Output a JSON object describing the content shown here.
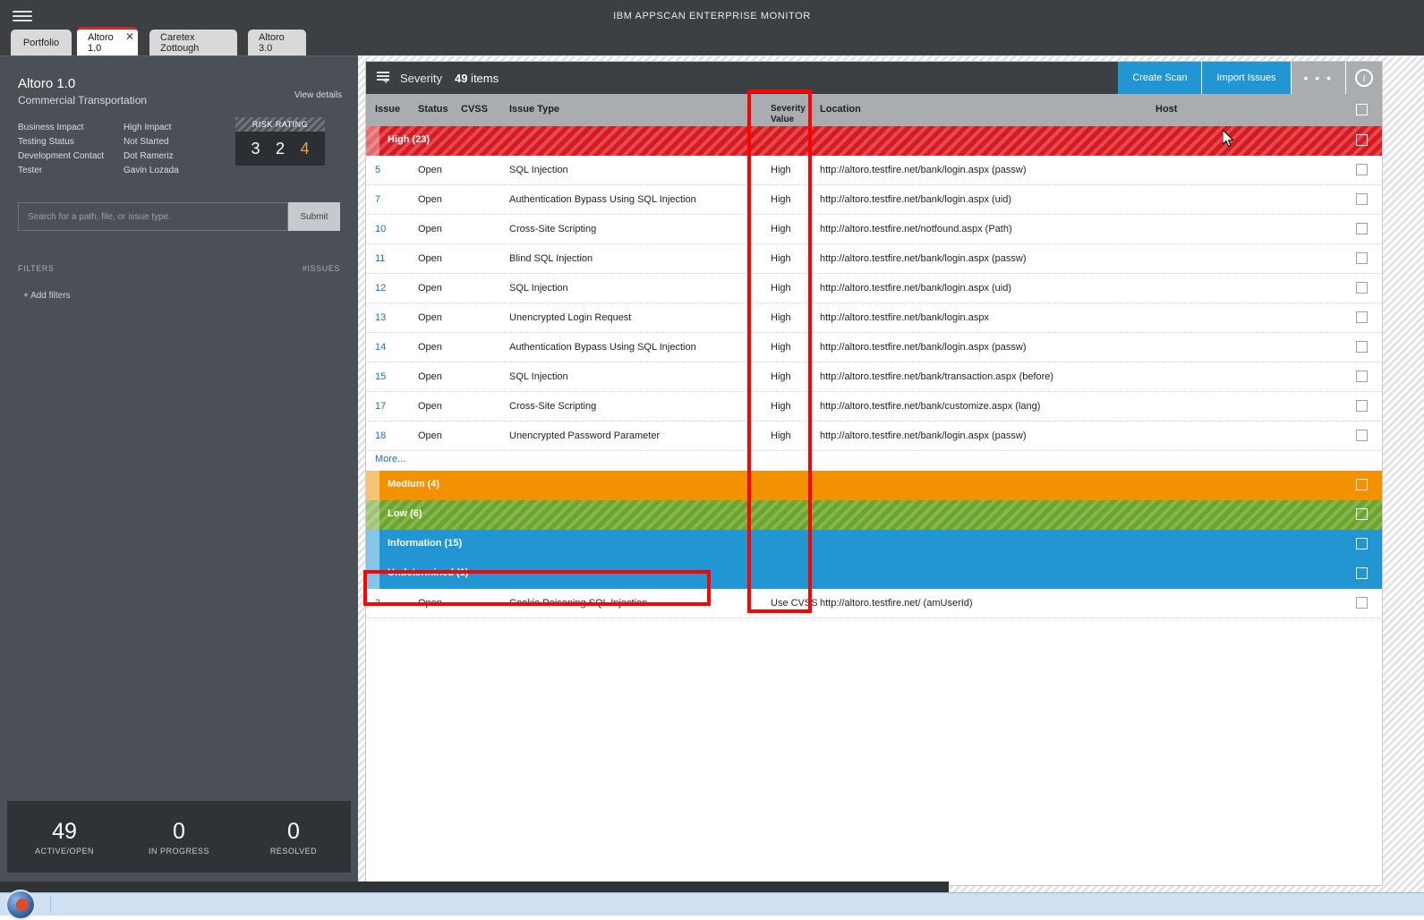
{
  "window": {
    "title": "IBM APPSCAN ENTERPRISE MONITOR",
    "menu_icon": "hamburger-icon"
  },
  "tabs": [
    {
      "label": "Portfolio",
      "active": false
    },
    {
      "label": "Altoro 1.0",
      "active": true,
      "close_glyph": "✕"
    },
    {
      "label": "Caretex Zottough",
      "active": false
    },
    {
      "label": "Altoro 3.0",
      "active": false
    }
  ],
  "sidebar": {
    "app_name": "Altoro 1.0",
    "app_subtitle": "Commercial Transportation",
    "view_details": "View details",
    "meta": [
      {
        "key": "Business Impact",
        "value": "High Impact"
      },
      {
        "key": "Testing Status",
        "value": "Not Started"
      },
      {
        "key": "Development Contact",
        "value": "Dot Rameriz"
      },
      {
        "key": "Tester",
        "value": "Gavin Lozada"
      }
    ],
    "risk": {
      "label": "RISK RATING",
      "d1": "3",
      "d2": "2",
      "d3": "4",
      "d3_color": "#e8a33d"
    },
    "search": {
      "placeholder": "Search for a path, file, or issue type.",
      "value": "",
      "submit_label": "Submit"
    },
    "filters": {
      "heading": "FILTERS",
      "issues_heading": "#ISSUES",
      "add_label": "+ Add filters"
    },
    "stats": [
      {
        "number": "49",
        "label": "ACTIVE/OPEN"
      },
      {
        "number": "0",
        "label": "IN PROGRESS"
      },
      {
        "number": "0",
        "label": "RESOLVED"
      }
    ]
  },
  "main": {
    "toolbar": {
      "icon": "severity-table-icon",
      "title": "Severity",
      "count": "49",
      "count_suffix": " items",
      "create_scan": "Create Scan",
      "import_issues": "Import Issues",
      "overflow": "• • •",
      "info_glyph": "i"
    },
    "columns": {
      "issue": "Issue",
      "status": "Status",
      "cvss": "CVSS",
      "issue_type": "Issue Type",
      "severity_value": "Severity Value",
      "location": "Location",
      "host": "Host"
    },
    "groups": [
      {
        "label": "High (23)",
        "color": "#d71920"
      },
      {
        "label": "Medium (4)",
        "color": "#f39200"
      },
      {
        "label": "Low (6)",
        "color": "#6ca52c"
      },
      {
        "label": "Information (15)",
        "color": "#2196d3"
      },
      {
        "label": "Undetermined (1)",
        "color": "#2196d3"
      }
    ],
    "more_label": "More...",
    "rows_high": [
      {
        "issue": "5",
        "status": "Open",
        "cvss": "",
        "type": "SQL Injection",
        "severity": "High",
        "location": "http://altoro.testfire.net/bank/login.aspx (passw)",
        "host": ""
      },
      {
        "issue": "7",
        "status": "Open",
        "cvss": "",
        "type": "Authentication Bypass Using SQL Injection",
        "severity": "High",
        "location": "http://altoro.testfire.net/bank/login.aspx (uid)",
        "host": ""
      },
      {
        "issue": "10",
        "status": "Open",
        "cvss": "",
        "type": "Cross-Site Scripting",
        "severity": "High",
        "location": "http://altoro.testfire.net/notfound.aspx (Path)",
        "host": ""
      },
      {
        "issue": "11",
        "status": "Open",
        "cvss": "",
        "type": "Blind SQL Injection",
        "severity": "High",
        "location": "http://altoro.testfire.net/bank/login.aspx (passw)",
        "host": ""
      },
      {
        "issue": "12",
        "status": "Open",
        "cvss": "",
        "type": "SQL Injection",
        "severity": "High",
        "location": "http://altoro.testfire.net/bank/login.aspx (uid)",
        "host": ""
      },
      {
        "issue": "13",
        "status": "Open",
        "cvss": "",
        "type": "Unencrypted Login Request",
        "severity": "High",
        "location": "http://altoro.testfire.net/bank/login.aspx",
        "host": ""
      },
      {
        "issue": "14",
        "status": "Open",
        "cvss": "",
        "type": "Authentication Bypass Using SQL Injection",
        "severity": "High",
        "location": "http://altoro.testfire.net/bank/login.aspx (passw)",
        "host": ""
      },
      {
        "issue": "15",
        "status": "Open",
        "cvss": "",
        "type": "SQL Injection",
        "severity": "High",
        "location": "http://altoro.testfire.net/bank/transaction.aspx (before)",
        "host": ""
      },
      {
        "issue": "17",
        "status": "Open",
        "cvss": "",
        "type": "Cross-Site Scripting",
        "severity": "High",
        "location": "http://altoro.testfire.net/bank/customize.aspx (lang)",
        "host": ""
      },
      {
        "issue": "18",
        "status": "Open",
        "cvss": "",
        "type": "Unencrypted Password Parameter",
        "severity": "High",
        "location": "http://altoro.testfire.net/bank/login.aspx (passw)",
        "host": ""
      }
    ],
    "row_undetermined": {
      "issue": "3",
      "status": "Open",
      "cvss": "",
      "type": "Cookie Poisoning SQL Injection",
      "severity": "Use CVSS",
      "location": "http://altoro.testfire.net/ (amUserId)",
      "host": ""
    }
  },
  "annotations": {
    "severity_column_highlight_color": "#ff0000",
    "cookie_row_highlight_color": "#ff0000"
  }
}
